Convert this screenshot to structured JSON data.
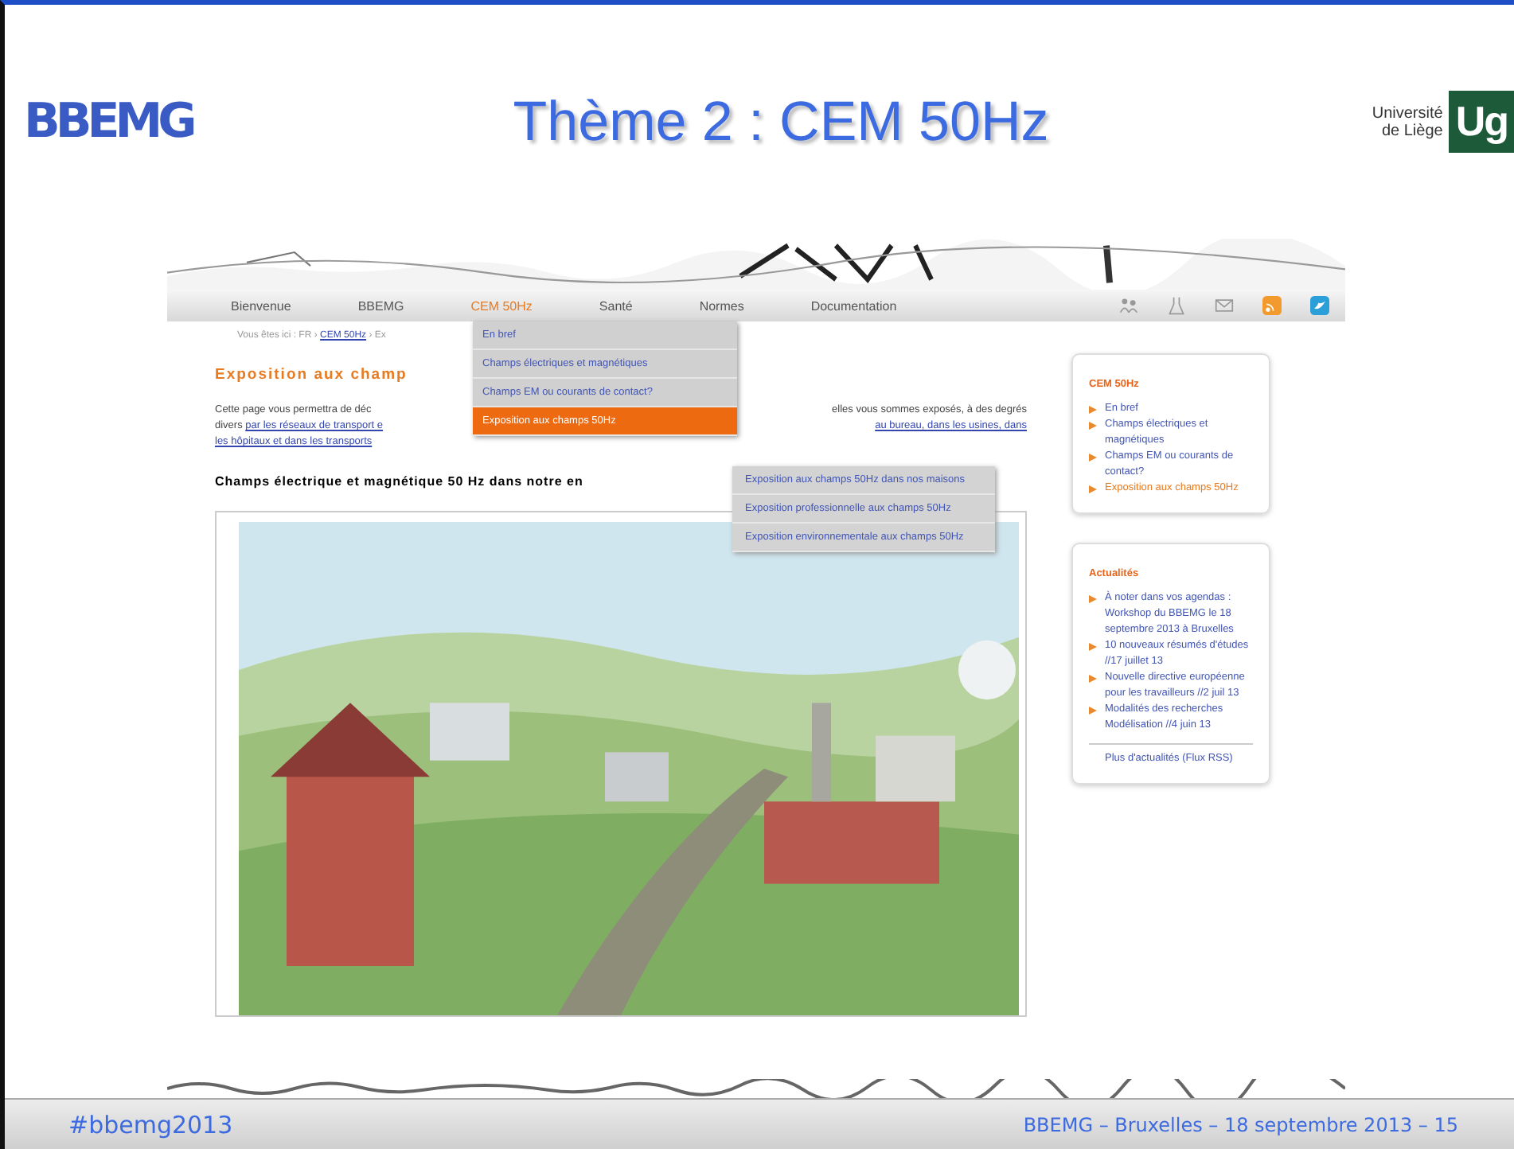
{
  "slide": {
    "logo_left": "BBEMG",
    "title": "Thème 2 : CEM 50Hz",
    "logo_right": {
      "text": "Université de Liège",
      "mark": "Ug"
    }
  },
  "website": {
    "nav": [
      {
        "label": "Bienvenue",
        "selected": false
      },
      {
        "label": "BBEMG",
        "selected": false
      },
      {
        "label": "CEM 50Hz",
        "selected": true
      },
      {
        "label": "Santé",
        "selected": false
      },
      {
        "label": "Normes",
        "selected": false
      },
      {
        "label": "Documentation",
        "selected": false
      }
    ],
    "dropdown": [
      {
        "label": "En bref",
        "selected": false
      },
      {
        "label": "Champs électriques et magnétiques",
        "selected": false
      },
      {
        "label": "Champs EM ou courants de contact?",
        "selected": false
      },
      {
        "label": "Exposition aux champs 50Hz",
        "selected": true
      }
    ],
    "submenu": [
      {
        "label": "Exposition aux champs 50Hz dans nos maisons"
      },
      {
        "label": "Exposition professionnelle aux champs 50Hz"
      },
      {
        "label": "Exposition environnementale aux champs 50Hz"
      }
    ],
    "breadcrumb": {
      "text": "Vous êtes ici : FR ›",
      "link": "CEM 50Hz",
      "rest": "› Ex"
    },
    "heading": "Exposition aux champ",
    "paragraph_left": [
      {
        "text": "Cette page vous permettra de déc"
      },
      {
        "text": "divers ",
        "link": "par les réseaux de transport e"
      },
      {
        "link": "les hôpitaux et dans les transports"
      }
    ],
    "paragraph_right": [
      {
        "text": "elles vous sommes exposés, à des degrés"
      },
      {
        "link": "au bureau, dans les usines, dans"
      }
    ],
    "subheading": "Champs électrique et magnétique 50 Hz dans notre en",
    "sidebar": [
      {
        "title": "CEM 50Hz",
        "items": [
          {
            "label": "En bref",
            "selected": false
          },
          {
            "label": "Champs électriques et magnétiques",
            "selected": false
          },
          {
            "label": "Champs EM ou courants de contact?",
            "selected": false
          },
          {
            "label": "Exposition aux champs 50Hz",
            "selected": true
          }
        ]
      },
      {
        "title": "Actualités",
        "items": [
          {
            "label": "À noter dans vos agendas : Workshop du BBEMG le 18 septembre 2013 à Bruxelles",
            "selected": false
          },
          {
            "label": "10 nouveaux résumés d'études //17 juillet 13",
            "selected": false
          },
          {
            "label": "Nouvelle directive européenne pour les travailleurs //2 juil 13",
            "selected": false
          },
          {
            "label": "Modalités des recherches Modélisation //4 juin 13",
            "selected": false
          }
        ],
        "more": "Plus d'actualités (Flux RSS)"
      }
    ]
  },
  "footer": {
    "left": "#bbemg2013",
    "right": "BBEMG – Bruxelles – 18 septembre 2013 – 15"
  }
}
